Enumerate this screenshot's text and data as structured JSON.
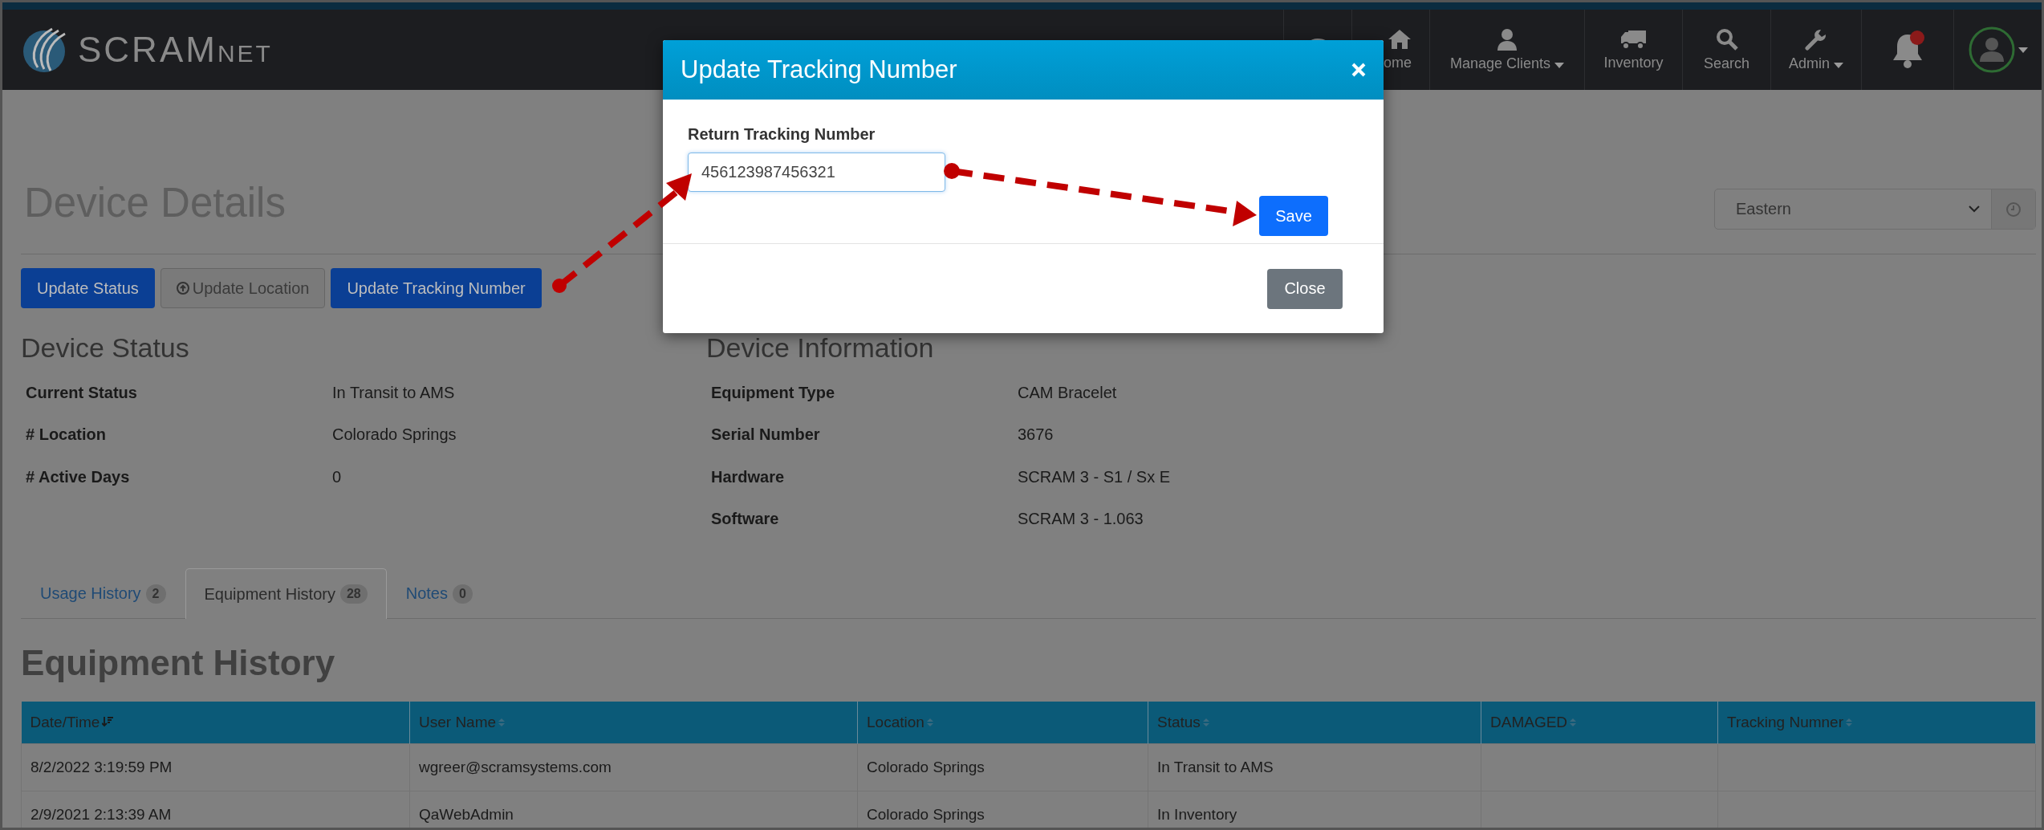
{
  "brand": {
    "name": "SCRAM",
    "suffix": "NET"
  },
  "nav": [
    {
      "kind": "palette"
    },
    {
      "kind": "home",
      "label": "ome"
    },
    {
      "kind": "user",
      "label": "Manage Clients",
      "dropdown": true
    },
    {
      "kind": "truck",
      "label": "Inventory"
    },
    {
      "kind": "search",
      "label": "Search"
    },
    {
      "kind": "wrench",
      "label": "Admin",
      "dropdown": true
    },
    {
      "kind": "bell",
      "alert": true
    },
    {
      "kind": "avatar",
      "dropdown": true
    }
  ],
  "page": {
    "title": "Device Details",
    "timezone": "Eastern"
  },
  "actions": [
    {
      "kind": "primary",
      "label": "Update Status"
    },
    {
      "kind": "secondary",
      "label": "Update Location"
    },
    {
      "kind": "primary",
      "label": "Update Tracking Number"
    }
  ],
  "device_status": {
    "title": "Device Status",
    "rows": [
      {
        "label": "Current Status",
        "value": "In Transit to AMS"
      },
      {
        "label": "# Location",
        "value": "Colorado Springs"
      },
      {
        "label": "# Active Days",
        "value": "0"
      }
    ]
  },
  "device_information": {
    "title": "Device Information",
    "rows": [
      {
        "label": "Equipment Type",
        "value": "CAM Bracelet"
      },
      {
        "label": "Serial Number",
        "value": "3676"
      },
      {
        "label": "Hardware",
        "value": "SCRAM 3 - S1 / Sx E"
      },
      {
        "label": "Software",
        "value": "SCRAM 3 - 1.063"
      }
    ]
  },
  "tabs": [
    {
      "label": "Usage History",
      "count": "2",
      "selected": false
    },
    {
      "label": "Equipment History",
      "count": "28",
      "selected": true
    },
    {
      "label": "Notes",
      "count": "0",
      "selected": false
    }
  ],
  "section_title": "Equipment History",
  "table": {
    "columns": [
      {
        "label": "Date/Time",
        "sorted": true
      },
      {
        "label": "User Name",
        "sorted": false
      },
      {
        "label": "Location",
        "sorted": false
      },
      {
        "label": "Status",
        "sorted": false
      },
      {
        "label": "DAMAGED",
        "sorted": false
      },
      {
        "label": "Tracking Numner",
        "sorted": false
      }
    ],
    "rows": [
      [
        "8/2/2022 3:19:59 PM",
        "wgreer@scramsystems.com",
        "Colorado Springs",
        "In Transit to AMS",
        "",
        ""
      ],
      [
        "2/9/2021 2:13:39 AM",
        "QaWebAdmin",
        "Colorado Springs",
        "In Inventory",
        "",
        ""
      ]
    ]
  },
  "modal": {
    "title": "Update Tracking Number",
    "field_label": "Return Tracking Number",
    "value": "456123987456321",
    "save": "Save",
    "close": "Close"
  }
}
